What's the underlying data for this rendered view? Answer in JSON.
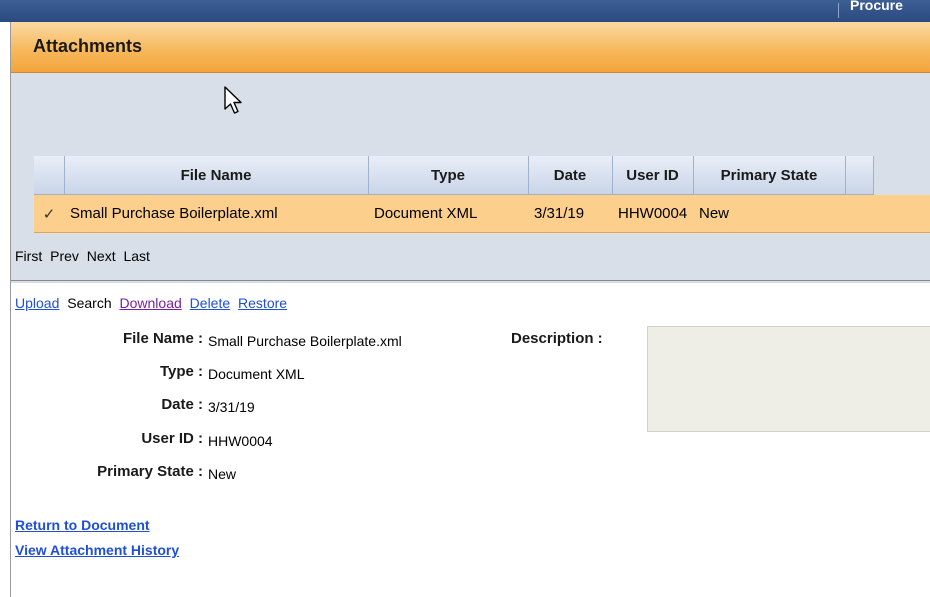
{
  "topbar": {
    "crumb": "Procure"
  },
  "panel": {
    "title": "Attachments"
  },
  "grid": {
    "columns": [
      "File Name",
      "Type",
      "Date",
      "User ID",
      "Primary State"
    ],
    "rows": [
      {
        "checked": "✓",
        "file_name": "Small Purchase Boilerplate.xml",
        "type": "Document XML",
        "date": "3/31/19",
        "user_id": "HHW0004",
        "primary_state": "New"
      }
    ]
  },
  "pager": {
    "first": "First",
    "prev": "Prev",
    "next": "Next",
    "last": "Last"
  },
  "actions": {
    "upload": "Upload",
    "search": "Search",
    "download": "Download",
    "delete": "Delete",
    "restore": "Restore"
  },
  "detail": {
    "file_name_label": "File Name :",
    "file_name": "Small Purchase Boilerplate.xml",
    "type_label": "Type :",
    "type": "Document XML",
    "date_label": "Date :",
    "date": "3/31/19",
    "user_id_label": "User ID :",
    "user_id": "HHW0004",
    "primary_state_label": "Primary State :",
    "primary_state": "New",
    "description_label": "Description :"
  },
  "links": {
    "return": "Return to Document",
    "history": "View Attachment History"
  },
  "colors": {
    "header_orange": "#f7b95c",
    "selected_row": "#fdcf8d",
    "link_blue": "#1f4fd6",
    "visited_purple": "#7b1fa2"
  }
}
